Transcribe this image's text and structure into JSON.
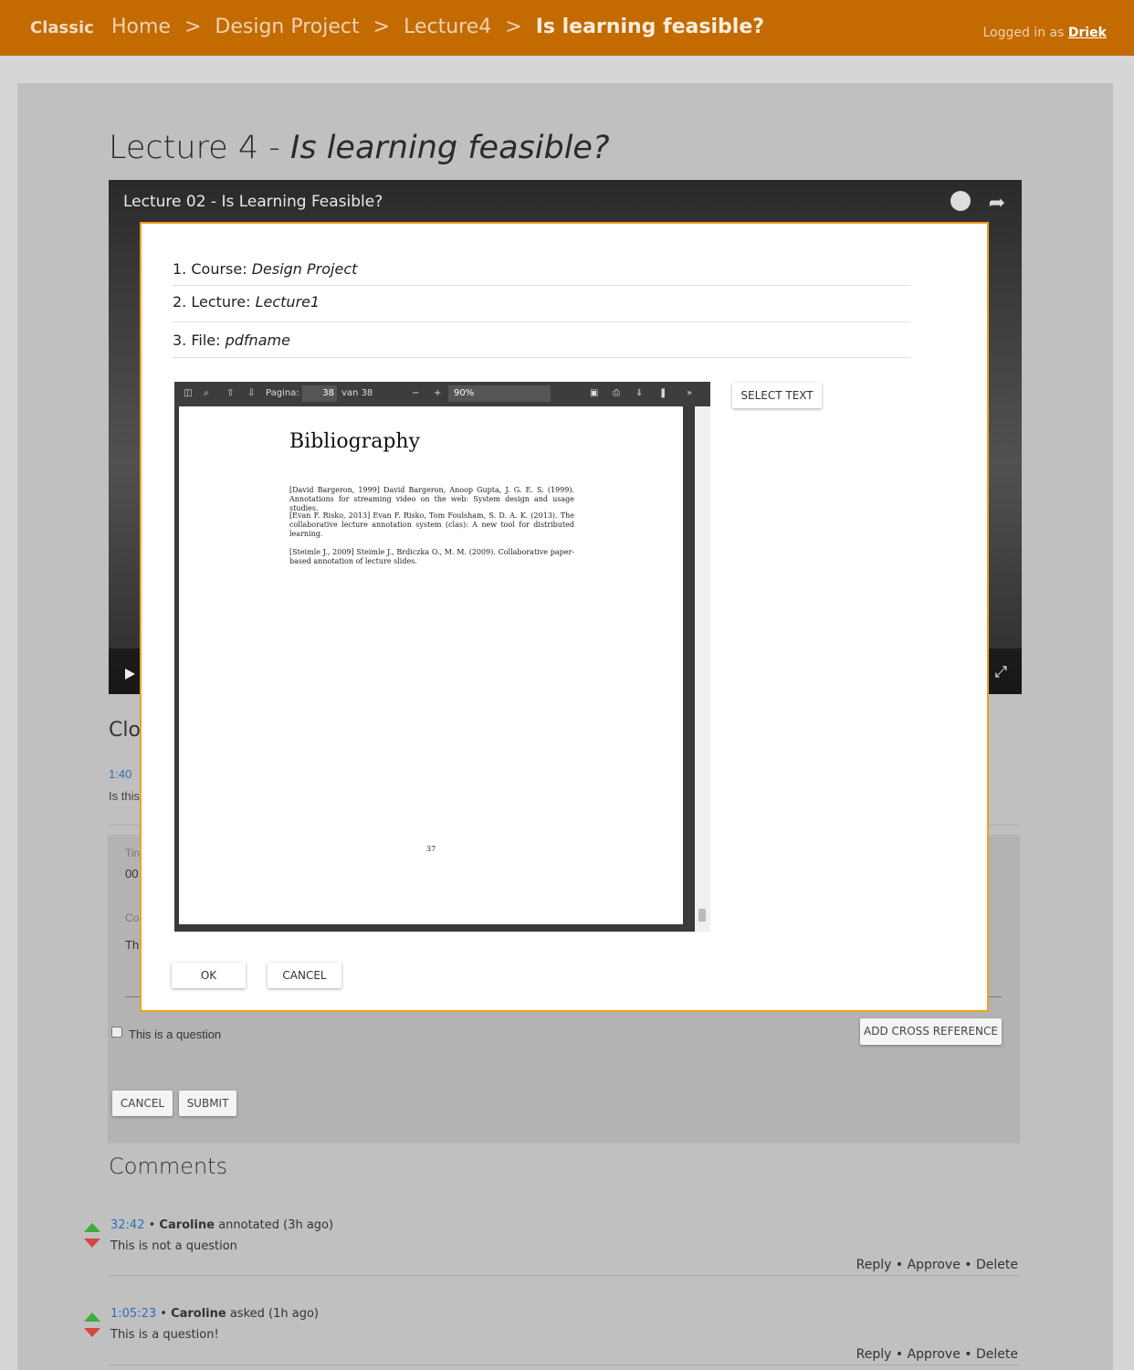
{
  "topbar": {
    "brand": "Classic",
    "breadcrumbs": [
      "Home",
      ">",
      "Design Project",
      ">",
      "Lecture4",
      ">",
      "Is learning feasible?"
    ],
    "logged_in_prefix": "Logged in as",
    "user": "Driek"
  },
  "page": {
    "title_main": "Lecture 4 -",
    "title_italic": "Is learning feasible?"
  },
  "video": {
    "title": "Lecture 02 - Is Learning Feasible?"
  },
  "background": {
    "close_title": "Clos",
    "time_link": "1:40",
    "question_text": "Is this",
    "time_label": "Tin",
    "time_value": "00",
    "comment_label": "Co",
    "comment_value": "Th",
    "checkbox_label": "This is a question",
    "add_xref_label": "ADD CROSS REFERENCE",
    "cancel_label": "CANCEL",
    "submit_label": "SUBMIT"
  },
  "modal": {
    "course_label": "1. Course:",
    "course_value": "Design Project",
    "lecture_label": "2. Lecture:",
    "lecture_value": "Lecture1",
    "file_label": "3. File:",
    "file_value": "pdfname",
    "select_text_label": "SELECT TEXT",
    "ok_label": "OK",
    "cancel_label": "CANCEL",
    "pdf": {
      "page_label": "Pagina:",
      "page_value": "38",
      "page_total": "van 38",
      "zoom": "90%",
      "heading": "Bibliography",
      "entries": [
        "[David Bargeron, 1999] David Bargeron, Anoop Gupta, J. G. E. S. (1999). Annotations for streaming video on the web: System design and usage studies.",
        "[Evan F. Risko, 2013] Evan F. Risko, Tom Foulsham, S. D. A. K. (2013). The collaborative lecture annotation system (clas): A new tool for distributed learning.",
        "[Steimle J., 2009] Steimle J., Brdiczka O., M. M. (2009). Collaborative paper-based annotation of lecture slides."
      ],
      "page_number": "37"
    }
  },
  "comments": {
    "title": "Comments",
    "items": [
      {
        "time": "32:42",
        "author": "Caroline",
        "action": "annotated (3h ago)",
        "text": "This is not a question",
        "reply": "Reply",
        "approve": "Approve",
        "delete": "Delete"
      },
      {
        "time": "1:05:23",
        "author": "Caroline",
        "action": "asked (1h ago)",
        "text": "This is a question!",
        "reply": "Reply",
        "approve": "Approve",
        "delete": "Delete"
      }
    ]
  },
  "colors": {
    "topbar": "#c36a00",
    "modal_border": "#f0a020",
    "link": "#2a6fb5",
    "vote_up": "#3bae3b",
    "vote_down": "#d64545"
  }
}
